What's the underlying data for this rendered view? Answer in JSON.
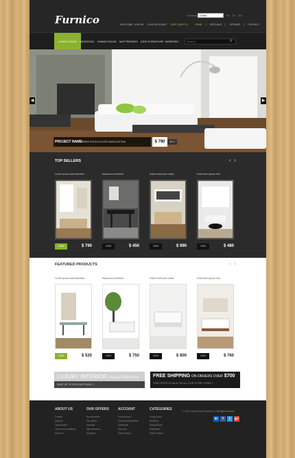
{
  "header": {
    "logo": "Furnico",
    "currency_label": "Currency:",
    "currency_value": "Dollar",
    "langs": "En  En  En",
    "top_links": [
      "WELCOME, JOIN IN!",
      "YOUR ACCOUNT",
      "CART: (EMPTY)"
    ],
    "top_nav": [
      "HOME",
      "SPECIALS",
      "SITEMAP",
      "CONTACT"
    ]
  },
  "main_nav": {
    "items": [
      "LIVING ROOM",
      "BEDROOM",
      "DINING ROOM",
      "MATTRESSES",
      "KIDS FURNITURE",
      "MIRRORS"
    ],
    "search_placeholder": "Search"
  },
  "slider": {
    "title": "PROJECT NAME:",
    "desc": "LOREM IPSUM DOLORE MASSA ESTIMA",
    "price": "$ 790",
    "info_label": "INFO",
    "prev": "◀",
    "next": "▶"
  },
  "top_sellers": {
    "title": "TOP SELLERS",
    "products": [
      {
        "name": "Lorem ipsum duis interdum",
        "price": "$ 790",
        "view": "VIEW"
      },
      {
        "name": "Massa es loremtum",
        "price": "$ 450",
        "view": "VIEW"
      },
      {
        "name": "Dolore interdum mode",
        "price": "$ 990",
        "view": "VIEW"
      },
      {
        "name": "Duit lorem ipsum sed",
        "price": "$ 480",
        "view": "VIEW"
      }
    ]
  },
  "featured": {
    "title": "FEATURED PRODUCTS",
    "products": [
      {
        "name": "Lorem ipsum duis interdum",
        "price": "$ 520",
        "view": "VIEW"
      },
      {
        "name": "Massa es loremtum",
        "price": "$ 750",
        "view": "VIEW"
      },
      {
        "name": "Dolore interdum mode",
        "price": "$ 800",
        "view": "VIEW"
      },
      {
        "name": "Duit lorem ipsum sed",
        "price": "$ 760",
        "view": "VIEW"
      }
    ]
  },
  "banners": {
    "left_title": "LUXURY INTERIOR",
    "left_title_small": "COLLECTION 2012",
    "left_sub": "SAVE UP TO 35%   SHOP NOW >",
    "right_title": "FREE SHIPPING",
    "right_title_small": "ON ORDERS OVER",
    "right_amount": "$700",
    "right_sub": "THIS OFFER IS VALID ON ALL OUR STORE ITEMS >"
  },
  "footer": {
    "columns": [
      {
        "title": "ABOUT US",
        "links": [
          "Contact",
          "Delivery",
          "Legal Notice",
          "Terms and conditions",
          "About us"
        ]
      },
      {
        "title": "OUR OFFERS",
        "links": [
          "New products",
          "Top sellers",
          "Specials",
          "Manufacturers",
          "Suppliers"
        ]
      },
      {
        "title": "ACCOUNT",
        "links": [
          "Your Account",
          "Personal information",
          "Addresses",
          "Discount",
          "Order history"
        ]
      },
      {
        "title": "CATEGORIES",
        "links": [
          "Living Room",
          "Bedroom",
          "Dining Room",
          "Mattresses",
          "Kids Furniture"
        ]
      }
    ],
    "copyright": "© 2012 Powered by PrestaShop™",
    "rights": "All rights reserved",
    "social": [
      "in",
      "f",
      "t",
      "g+"
    ]
  },
  "colors": {
    "accent": "#8cb12d",
    "dark": "#2b2b2b"
  }
}
